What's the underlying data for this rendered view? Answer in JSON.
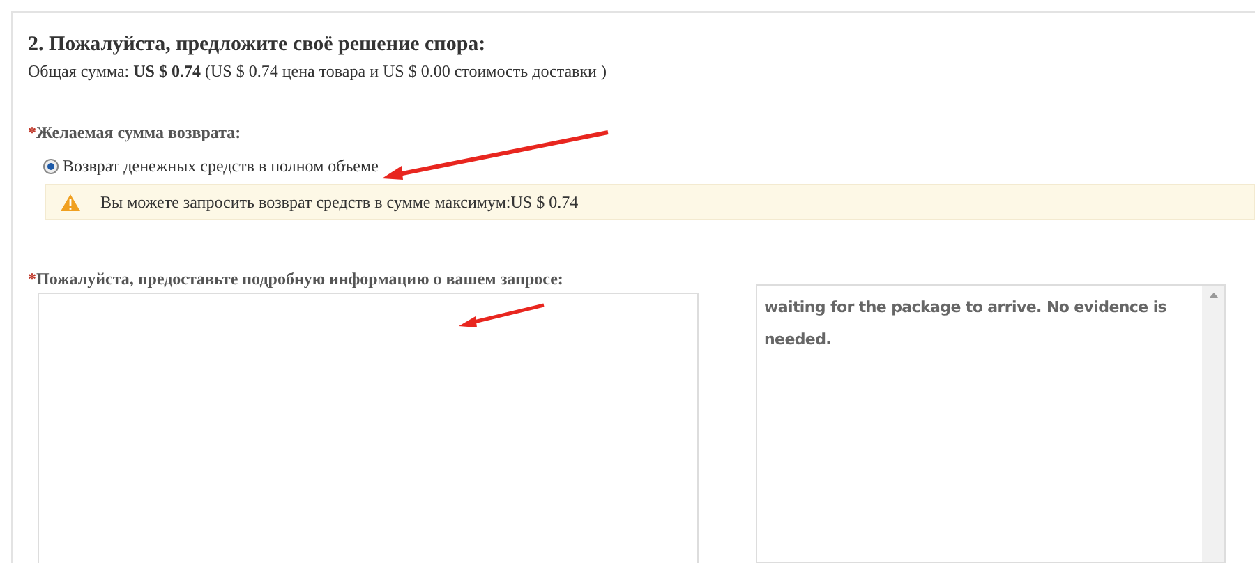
{
  "section_title": "2. Пожалуйста, предложите своё решение спора:",
  "summary": "Общая сумма: **US $ 0.74** (US $ 0.74 цена товара и US $ 0.00 стоимость доставки )",
  "refund_field": {
    "marker": "*",
    "label": "Желаемая сумма возврата:",
    "options": [
      {
        "label": "Возврат денежных средств в полном объеме",
        "selected": true
      }
    ]
  },
  "warning": "Вы можете запросить возврат средств в сумме максимум:US $ 0.74",
  "details_field": {
    "marker": "*",
    "label": "Пожалуйста, предоставьте подробную информацию о вашем запросе:"
  },
  "hint_box": {
    "text": "waiting for the package to arrive. No evidence is needed."
  }
}
